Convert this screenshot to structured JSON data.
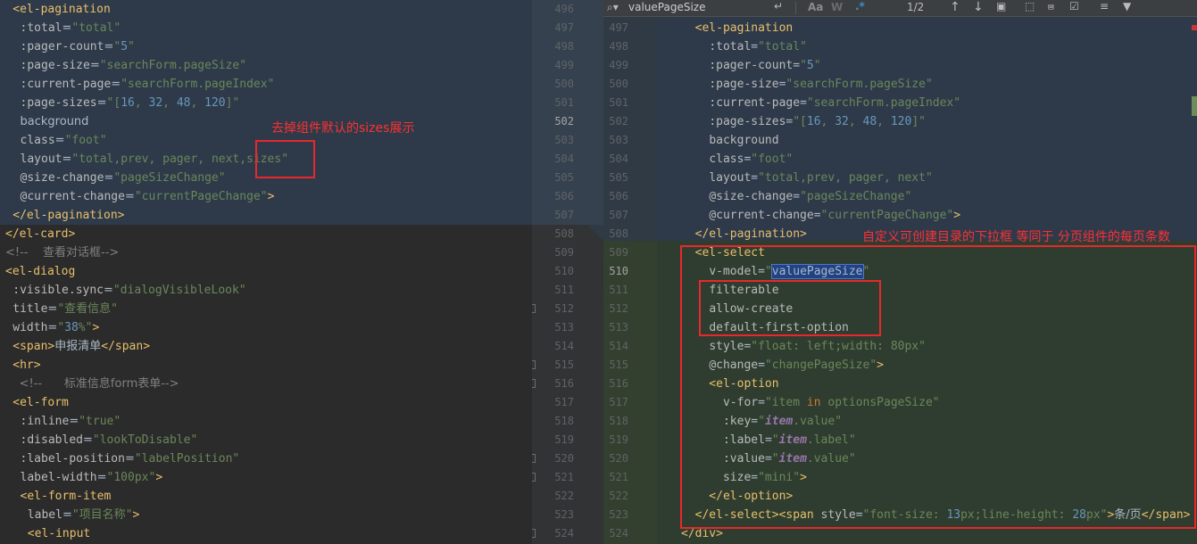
{
  "left": {
    "lines": [
      [
        "  <el-pagination"
      ],
      [
        "    :total=\"total\""
      ],
      [
        "    :pager-count=\"5\""
      ],
      [
        "    :page-size=\"searchForm.pageSize\""
      ],
      [
        "    :current-page=\"searchForm.pageIndex\""
      ],
      [
        "    :page-sizes=\"[16, 32, 48, 120]\""
      ],
      [
        "    background"
      ],
      [
        "    class=\"foot\""
      ],
      [
        "    layout=\"total,prev, pager, next,sizes\""
      ],
      [
        "    @size-change=\"pageSizeChange\""
      ],
      [
        "    @current-change=\"currentPageChange\">"
      ],
      [
        "  </el-pagination>"
      ],
      [
        "</el-card>"
      ],
      [
        "<!--    查看对话框-->"
      ],
      [
        "<el-dialog"
      ],
      [
        "  :visible.sync=\"dialogVisibleLook\""
      ],
      [
        "  title=\"查看信息\""
      ],
      [
        "  width=\"38%\">"
      ],
      [
        "  <span>申报清单</span>"
      ],
      [
        "  <hr>"
      ],
      [
        "  <!--      标准信息form表单-->"
      ],
      [
        "  <el-form"
      ],
      [
        "    :inline=\"true\""
      ],
      [
        "    :disabled=\"lookToDisable\""
      ],
      [
        "    :label-position=\"labelPosition\""
      ],
      [
        "    label-width=\"100px\">"
      ],
      [
        "    <el-form-item"
      ],
      [
        "      label=\"项目名称\">"
      ],
      [
        "      <el-input"
      ]
    ],
    "annotation": "去掉组件默认的sizes展示"
  },
  "gutter": {
    "left_numbers": [
      "496",
      "497",
      "498",
      "499",
      "500",
      "501",
      "502",
      "503",
      "504",
      "505",
      "506",
      "507",
      "508",
      "509",
      "510",
      "511",
      "512",
      "513",
      "514",
      "515",
      "516",
      "517",
      "518",
      "519",
      "520",
      "521",
      "522",
      "523",
      "524"
    ],
    "right_numbers": [
      "",
      "497",
      "498",
      "499",
      "500",
      "501",
      "502",
      "503",
      "504",
      "505",
      "506",
      "507",
      "508",
      "509",
      "510",
      "511",
      "512",
      "513",
      "514",
      "515",
      "516",
      "517",
      "518",
      "519",
      "520",
      "521",
      "522",
      "523",
      "524"
    ]
  },
  "search": {
    "query": "valuePageSize",
    "match_case": "Aa",
    "words": "W",
    "regex": ".*",
    "count": "1/2"
  },
  "right": {
    "annotation": "自定义可创建目录的下拉框 等同于 分页组件的每页条数"
  },
  "colors": {
    "tag": "#e8bf6a",
    "string": "#6a8759",
    "comment": "#808080",
    "number": "#6897bb",
    "annotation": "#e8282b",
    "diff_changed_bg": "#2e3a4a",
    "diff_added_bg": "#2f3d30"
  }
}
